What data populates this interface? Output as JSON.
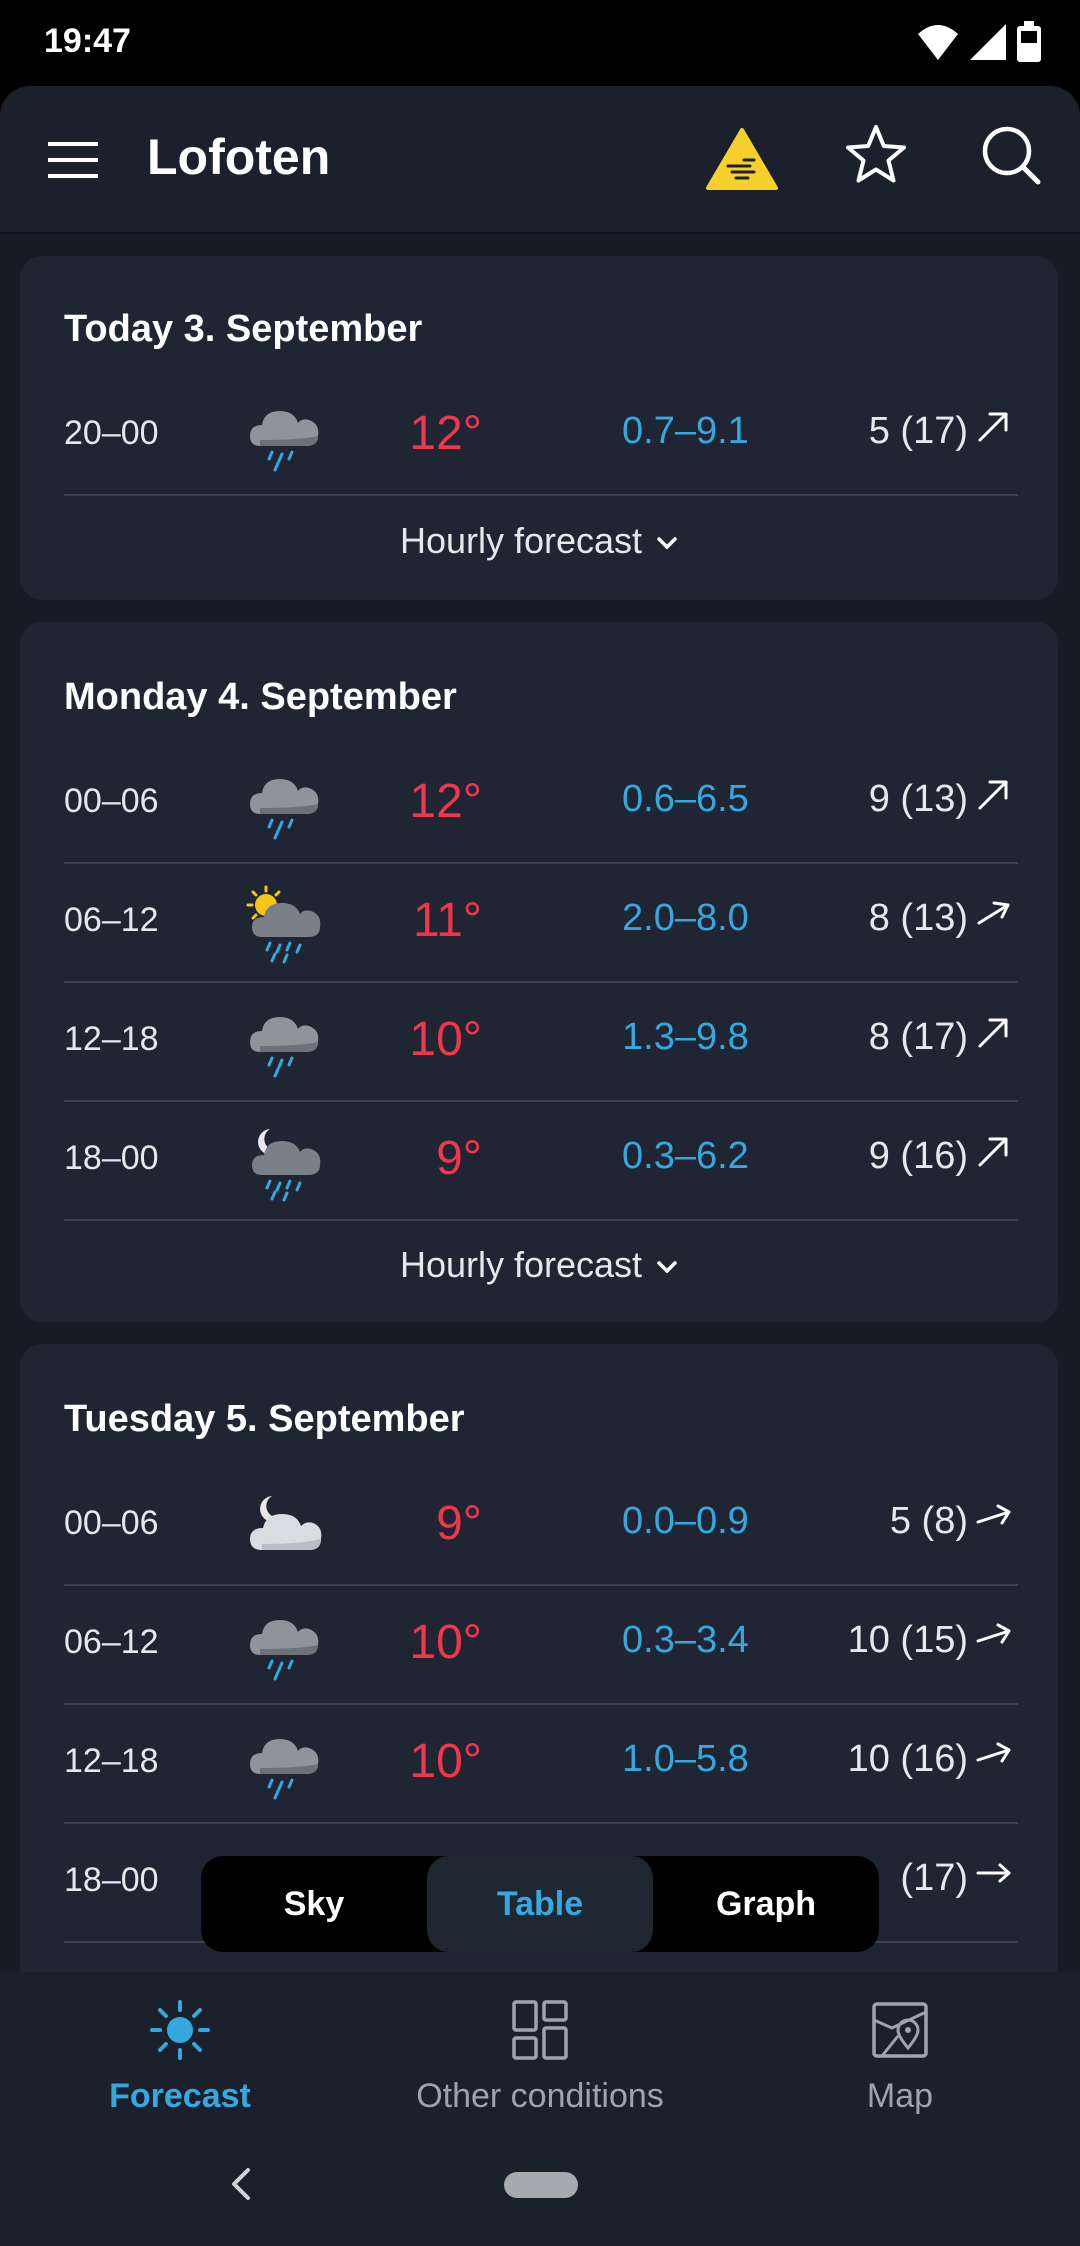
{
  "status": {
    "time": "19:47"
  },
  "header": {
    "title": "Lofoten"
  },
  "days": [
    {
      "title": "Today 3. September",
      "hourly_label": "Hourly forecast",
      "rows": [
        {
          "period": "20–00",
          "icon": "rain-cloud-icon",
          "temp": "12°",
          "precip": "0.7–9.1",
          "wind": "5 (17)"
        }
      ]
    },
    {
      "title": "Monday 4. September",
      "hourly_label": "Hourly forecast",
      "rows": [
        {
          "period": "00–06",
          "icon": "rain-cloud-icon",
          "temp": "12°",
          "precip": "0.6–6.5",
          "wind": "9 (13)"
        },
        {
          "period": "06–12",
          "icon": "sun-rain-cloud-icon",
          "temp": "11°",
          "precip": "2.0–8.0",
          "wind": "8 (13)"
        },
        {
          "period": "12–18",
          "icon": "rain-cloud-icon",
          "temp": "10°",
          "precip": "1.3–9.8",
          "wind": "8 (17)"
        },
        {
          "period": "18–00",
          "icon": "moon-rain-cloud-icon",
          "temp": "9°",
          "precip": "0.3–6.2",
          "wind": "9 (16)"
        }
      ]
    },
    {
      "title": "Tuesday 5. September",
      "rows": [
        {
          "period": "00–06",
          "icon": "moon-cloud-icon",
          "temp": "9°",
          "precip": "0.0–0.9",
          "wind": "5 (8)"
        },
        {
          "period": "06–12",
          "icon": "rain-cloud-icon",
          "temp": "10°",
          "precip": "0.3–3.4",
          "wind": "10 (15)"
        },
        {
          "period": "12–18",
          "icon": "rain-cloud-icon",
          "temp": "10°",
          "precip": "1.0–5.8",
          "wind": "10 (16)"
        },
        {
          "period": "18–00",
          "wind": "(17)"
        }
      ]
    }
  ],
  "view_toggle": {
    "sky": "Sky",
    "table": "Table",
    "graph": "Graph",
    "selected": "Table"
  },
  "nav": {
    "forecast": "Forecast",
    "other": "Other conditions",
    "map": "Map"
  },
  "colors": {
    "accent": "#35a8e0",
    "temperature": "#f0364a",
    "background": "#171c26",
    "card": "#1f2532",
    "warning": "#f7d02c"
  }
}
